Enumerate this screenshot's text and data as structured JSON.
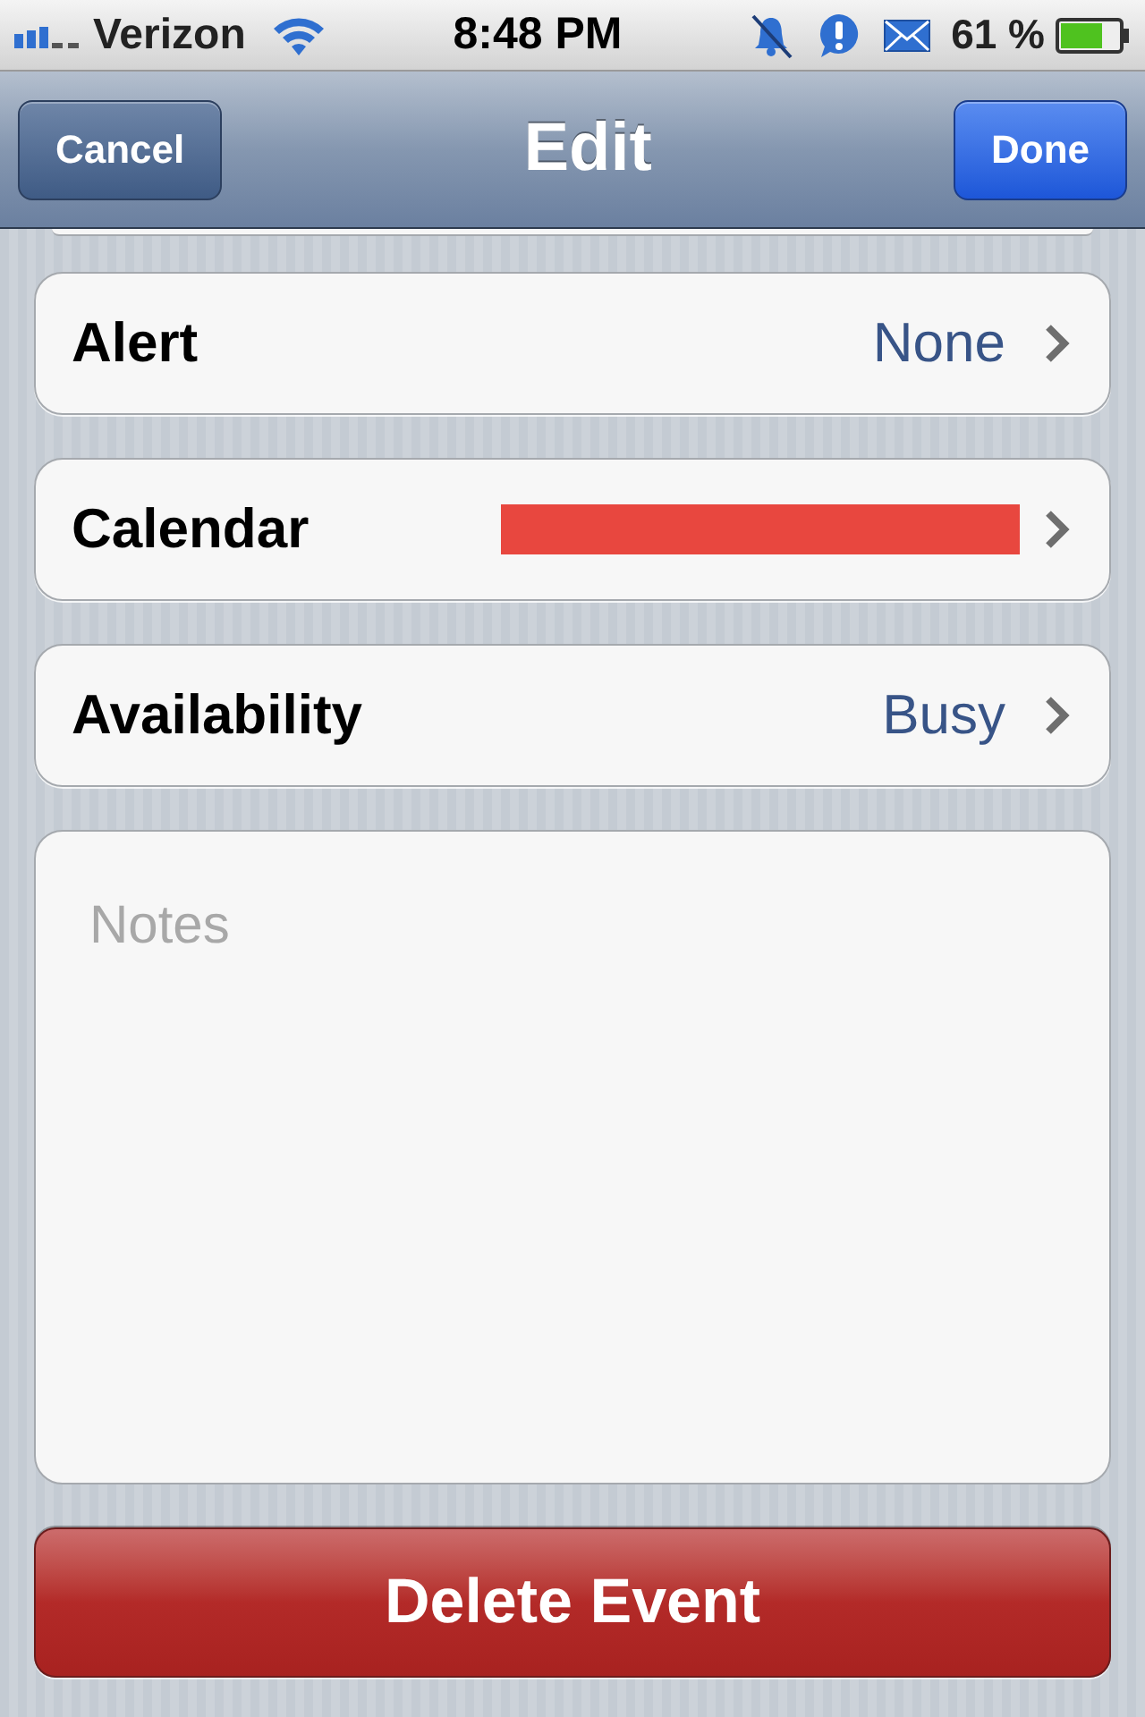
{
  "status_bar": {
    "carrier": "Verizon",
    "time": "8:48 PM",
    "battery": "61 %"
  },
  "nav_bar": {
    "title": "Edit",
    "buttons": [
      {
        "label": "Cancel",
        "kind": "plain"
      },
      {
        "label": "Done",
        "kind": "primary"
      }
    ]
  },
  "rows": [
    {
      "label": "Alert",
      "value": "None",
      "redacted": false
    },
    {
      "label": "Calendar",
      "redacted": true
    },
    {
      "label": "Availability",
      "value": "Busy",
      "redacted": false
    }
  ],
  "notes": {
    "placeholder": "Notes"
  },
  "delete_button": {
    "label": "Delete Event"
  }
}
